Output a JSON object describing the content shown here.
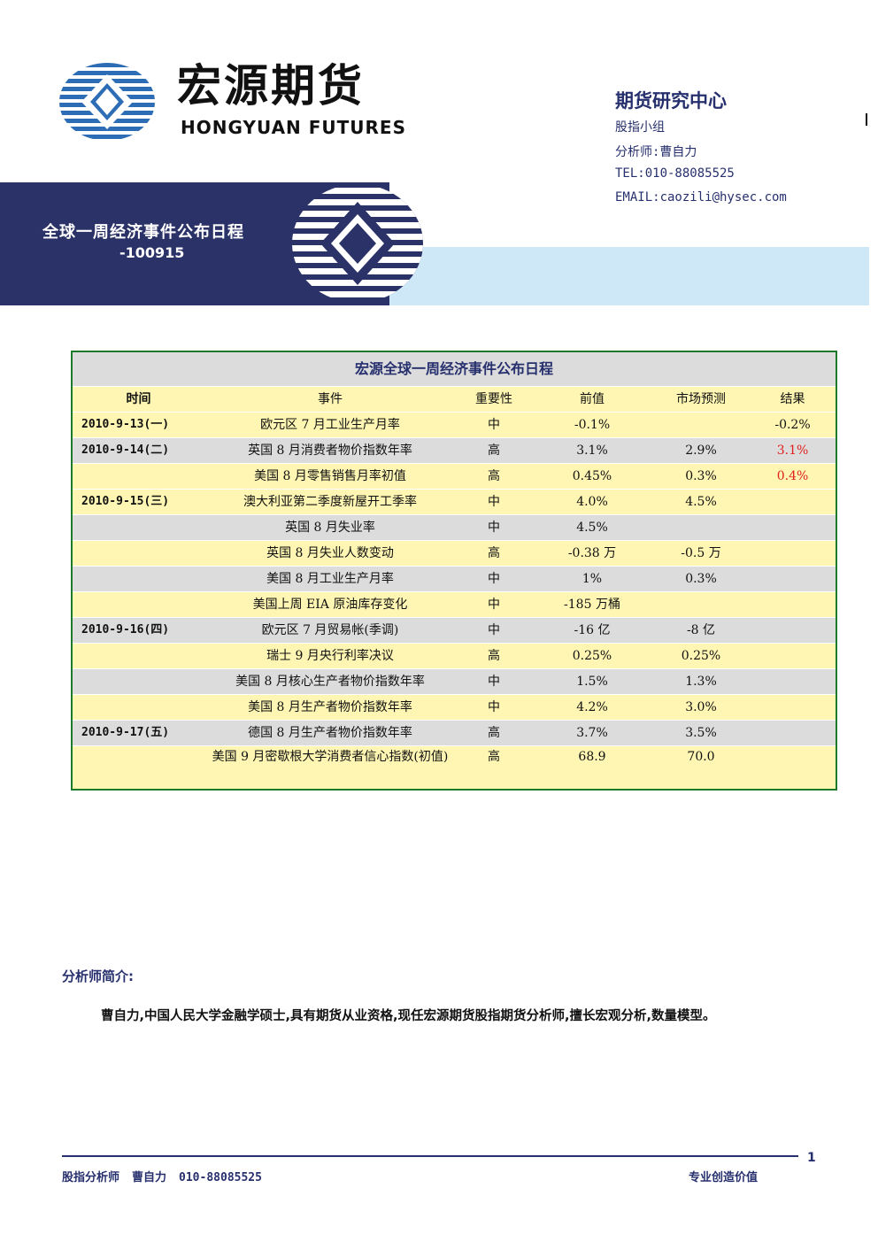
{
  "brand": {
    "name_cn": "宏源期货",
    "name_en": "HONGYUAN FUTURES",
    "primary_color": "#2b3268",
    "light_color": "#cfe8f7"
  },
  "header": {
    "department": "期货研究中心",
    "group": "股指小组",
    "analyst": "分析师:曹自力",
    "tel": "TEL:010-88085525",
    "email": "EMAIL:caozili@hysec.com"
  },
  "banner": {
    "title": "全球一周经济事件公布日程",
    "date": "-100915"
  },
  "table": {
    "caption": "宏源全球一周经济事件公布日程",
    "headers": [
      "时间",
      "事件",
      "重要性",
      "前值",
      "市场预测",
      "结果"
    ],
    "rows": [
      {
        "date": "2010-9-13(一)",
        "event": "欧元区 7 月工业生产月率",
        "importance": "中",
        "previous": "-0.1%",
        "forecast": "",
        "result": "-0.2%",
        "result_red": false
      },
      {
        "date": "2010-9-14(二)",
        "event": "英国 8 月消费者物价指数年率",
        "importance": "高",
        "previous": "3.1%",
        "forecast": "2.9%",
        "result": "3.1%",
        "result_red": true
      },
      {
        "date": "",
        "event": "美国 8 月零售销售月率初值",
        "importance": "高",
        "previous": "0.45%",
        "forecast": "0.3%",
        "result": "0.4%",
        "result_red": true
      },
      {
        "date": "2010-9-15(三)",
        "event": "澳大利亚第二季度新屋开工季率",
        "importance": "中",
        "previous": "4.0%",
        "forecast": "4.5%",
        "result": "",
        "result_red": false
      },
      {
        "date": "",
        "event": "英国 8 月失业率",
        "importance": "中",
        "previous": "4.5%",
        "forecast": "",
        "result": "",
        "result_red": false
      },
      {
        "date": "",
        "event": "英国 8 月失业人数变动",
        "importance": "高",
        "previous": "-0.38 万",
        "forecast": "-0.5 万",
        "result": "",
        "result_red": false
      },
      {
        "date": "",
        "event": "美国 8 月工业生产月率",
        "importance": "中",
        "previous": "1%",
        "forecast": "0.3%",
        "result": "",
        "result_red": false
      },
      {
        "date": "",
        "event": "美国上周 EIA 原油库存变化",
        "importance": "中",
        "previous": "-185 万桶",
        "forecast": "",
        "result": "",
        "result_red": false
      },
      {
        "date": "2010-9-16(四)",
        "event": "欧元区 7 月贸易帐(季调)",
        "importance": "中",
        "previous": "-16 亿",
        "forecast": "-8 亿",
        "result": "",
        "result_red": false
      },
      {
        "date": "",
        "event": "瑞士 9 月央行利率决议",
        "importance": "高",
        "previous": "0.25%",
        "forecast": "0.25%",
        "result": "",
        "result_red": false
      },
      {
        "date": "",
        "event": "美国 8 月核心生产者物价指数年率",
        "importance": "中",
        "previous": "1.5%",
        "forecast": "1.3%",
        "result": "",
        "result_red": false
      },
      {
        "date": "",
        "event": "美国 8 月生产者物价指数年率",
        "importance": "中",
        "previous": "4.2%",
        "forecast": "3.0%",
        "result": "",
        "result_red": false
      },
      {
        "date": "2010-9-17(五)",
        "event": "德国 8 月生产者物价指数年率",
        "importance": "高",
        "previous": "3.7%",
        "forecast": "3.5%",
        "result": "",
        "result_red": false
      },
      {
        "date": "",
        "event": "美国 9 月密歇根大学消费者信心指数(初值)",
        "importance": "高",
        "previous": "68.9",
        "forecast": "70.0",
        "result": "",
        "result_red": false
      }
    ]
  },
  "bio": {
    "title": "分析师简介:",
    "text": "曹自力,中国人民大学金融学硕士,具有期货从业资格,现任宏源期货股指期货分析师,擅长宏观分析,数量模型。"
  },
  "footer": {
    "role": "股指分析师",
    "name": "曹自力",
    "phone": "010-88085525",
    "slogan": "专业创造价值",
    "page": "1"
  }
}
